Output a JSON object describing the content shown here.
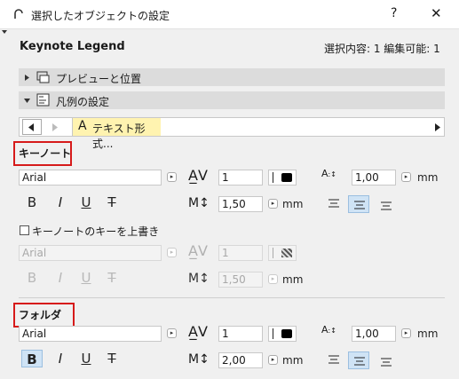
{
  "title": "選択したオブジェクトの設定",
  "help": "?",
  "close": "✕",
  "header": {
    "name": "Keynote Legend",
    "info": "選択内容: 1 編集可能: 1"
  },
  "sections": {
    "preview": "プレビューと位置",
    "legend": "凡例の設定"
  },
  "tab": {
    "label": "テキスト形式..."
  },
  "keynote": {
    "heading": "キーノート",
    "font": "Arial",
    "width_value": "1",
    "spacing_value": "1,00",
    "height_value": "1,50",
    "unit": "mm",
    "unit2": "mm",
    "unit3": "mm"
  },
  "override": {
    "checkbox_label": "キーノートのキーを上書き",
    "font": "Arial",
    "width_value": "1",
    "height_value": "1,50",
    "unit": "mm"
  },
  "folder": {
    "heading": "フォルダ",
    "font": "Arial",
    "width_value": "1",
    "spacing_value": "1,00",
    "height_value": "2,00",
    "unit": "mm",
    "unit2": "mm",
    "unit3": "mm"
  },
  "icons": {
    "bold": "B",
    "italic": "I",
    "underline": "U",
    "strike": "T"
  },
  "colors": {
    "highlight_tab": "#fff3b0",
    "selected": "#cfe3f5",
    "red_box": "#d61a1a"
  }
}
